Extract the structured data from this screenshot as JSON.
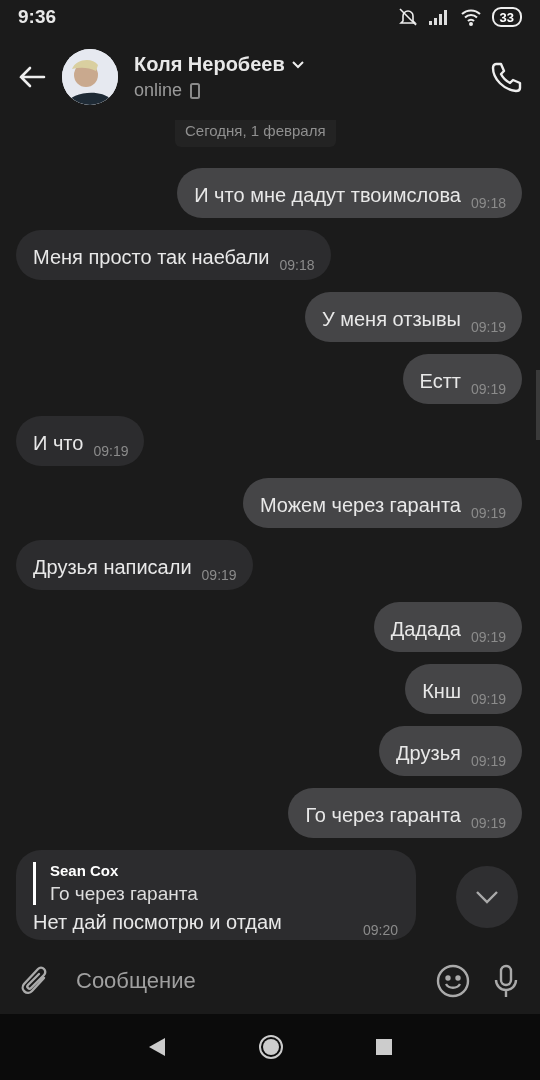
{
  "status_bar": {
    "time": "9:36",
    "battery": "33"
  },
  "header": {
    "name": "Коля Неробеев",
    "status": "online"
  },
  "date_badge": "Сегодня, 1 февраля",
  "messages": [
    {
      "kind": "outgoing",
      "text": "И что мне дадут твоимслова",
      "time": "09:18"
    },
    {
      "kind": "incoming",
      "text": "Меня просто так наебали",
      "time": "09:18"
    },
    {
      "kind": "outgoing",
      "text": "У меня отзывы",
      "time": "09:19"
    },
    {
      "kind": "outgoing",
      "text": "Естт",
      "time": "09:19"
    },
    {
      "kind": "incoming",
      "text": "И что",
      "time": "09:19"
    },
    {
      "kind": "outgoing",
      "text": "Можем через гаранта",
      "time": "09:19"
    },
    {
      "kind": "incoming",
      "text": "Друзья написали",
      "time": "09:19"
    },
    {
      "kind": "outgoing",
      "text": "Дадада",
      "time": "09:19"
    },
    {
      "kind": "outgoing",
      "text": "Кнш",
      "time": "09:19"
    },
    {
      "kind": "outgoing",
      "text": "Друзья",
      "time": "09:19"
    },
    {
      "kind": "outgoing",
      "text": "Го через гаранта",
      "time": "09:19"
    },
    {
      "kind": "incoming",
      "text": "Нет дай посмотрю и отдам",
      "time": "09:20",
      "reply": {
        "author": "Sean Cox",
        "text": "Го через гаранта"
      }
    }
  ],
  "composer": {
    "placeholder": "Сообщение"
  }
}
